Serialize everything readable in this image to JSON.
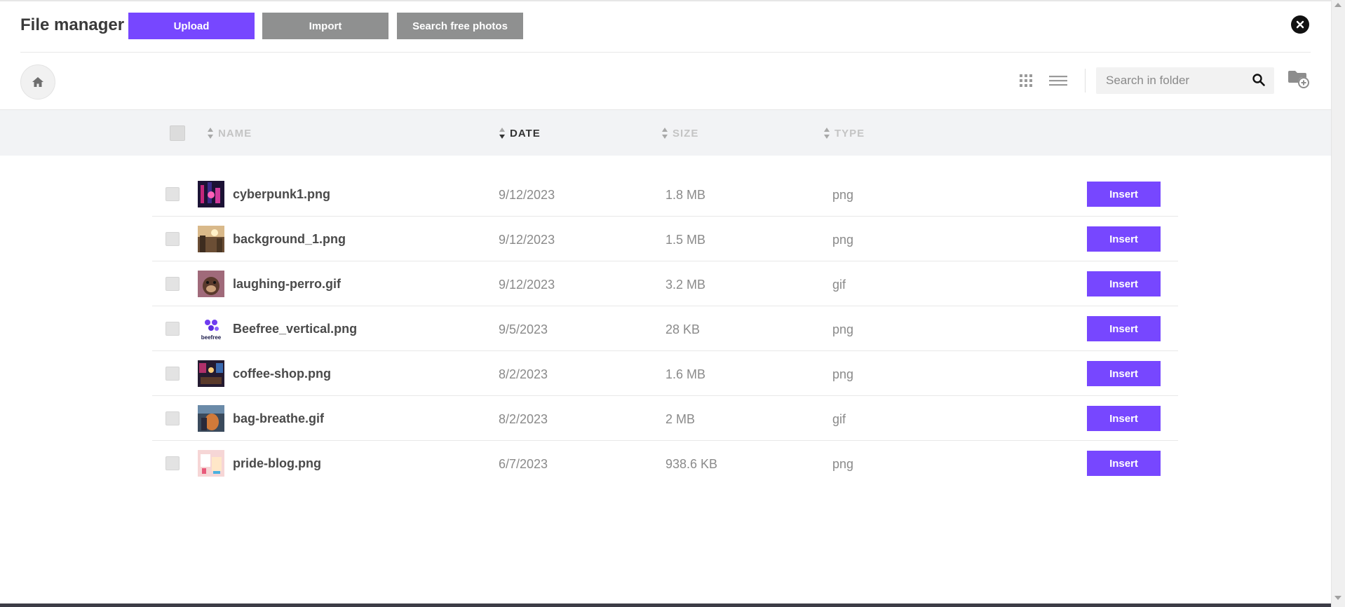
{
  "header": {
    "title": "File manager",
    "upload_label": "Upload",
    "import_label": "Import",
    "search_photos_label": "Search free photos"
  },
  "toolbar": {
    "search_placeholder": "Search in folder"
  },
  "table": {
    "columns": {
      "name": "NAME",
      "date": "DATE",
      "size": "SIZE",
      "type": "TYPE"
    },
    "sorted_by": "DATE",
    "rows": [
      {
        "name": "cyberpunk1.png",
        "date": "9/12/2023",
        "size": "1.8 MB",
        "type": "png",
        "action": "Insert"
      },
      {
        "name": "background_1.png",
        "date": "9/12/2023",
        "size": "1.5 MB",
        "type": "png",
        "action": "Insert"
      },
      {
        "name": "laughing-perro.gif",
        "date": "9/12/2023",
        "size": "3.2 MB",
        "type": "gif",
        "action": "Insert"
      },
      {
        "name": "Beefree_vertical.png",
        "date": "9/5/2023",
        "size": "28 KB",
        "type": "png",
        "action": "Insert",
        "thumb_text": "beefree"
      },
      {
        "name": "coffee-shop.png",
        "date": "8/2/2023",
        "size": "1.6 MB",
        "type": "png",
        "action": "Insert"
      },
      {
        "name": "bag-breathe.gif",
        "date": "8/2/2023",
        "size": "2 MB",
        "type": "gif",
        "action": "Insert"
      },
      {
        "name": "pride-blog.png",
        "date": "6/7/2023",
        "size": "938.6 KB",
        "type": "png",
        "action": "Insert"
      }
    ]
  },
  "colors": {
    "accent": "#7747ff",
    "secondary_button": "#8f9090",
    "header_bg": "#f2f3f5"
  },
  "icons": [
    "close-icon",
    "home-icon",
    "grid-view-icon",
    "list-view-icon",
    "search-icon",
    "new-folder-icon",
    "sort-icon"
  ]
}
